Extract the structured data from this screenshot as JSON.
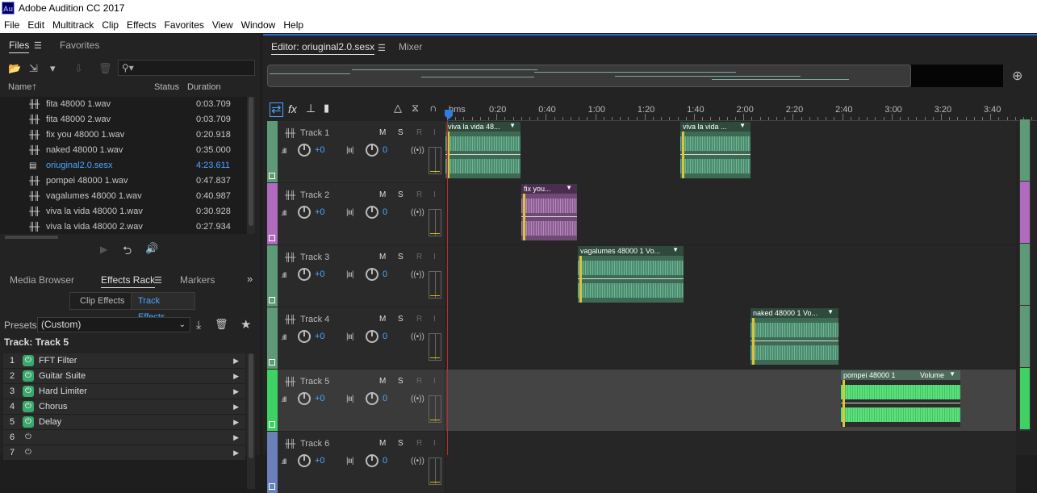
{
  "app": {
    "logo": "Au",
    "title": "Adobe Audition CC 2017"
  },
  "menu": [
    "File",
    "Edit",
    "Multitrack",
    "Clip",
    "Effects",
    "Favorites",
    "View",
    "Window",
    "Help"
  ],
  "files_panel": {
    "tabs": [
      "Files",
      "Favorites"
    ],
    "search_icon": "search-icon",
    "columns": {
      "name": "Name",
      "status": "Status",
      "duration": "Duration"
    },
    "rows": [
      {
        "name": "fita 48000 1.wav",
        "duration": "0:03.709"
      },
      {
        "name": "fita 48000 2.wav",
        "duration": "0:03.709"
      },
      {
        "name": "fix you 48000 1.wav",
        "duration": "0:20.918"
      },
      {
        "name": "naked 48000 1.wav",
        "duration": "0:35.000"
      },
      {
        "name": "oriuginal2.0.sesx",
        "duration": "4:23.611",
        "selected": true
      },
      {
        "name": "pompei 48000 1.wav",
        "duration": "0:47.837"
      },
      {
        "name": "vagalumes 48000 1.wav",
        "duration": "0:40.987"
      },
      {
        "name": "viva la vida 48000 1.wav",
        "duration": "0:30.928"
      },
      {
        "name": "viva la vida 48000 2.wav",
        "duration": "0:27.934"
      }
    ]
  },
  "effects_panel": {
    "tabs": [
      "Media Browser",
      "Effects Rack",
      "Markers"
    ],
    "subtabs": [
      "Clip Effects",
      "Track Effects"
    ],
    "presets_label": "Presets:",
    "presets_value": "(Custom)",
    "track_label": "Track: Track 5",
    "effects": [
      {
        "num": "1",
        "name": "FFT Filter",
        "on": true
      },
      {
        "num": "2",
        "name": "Guitar Suite",
        "on": true
      },
      {
        "num": "3",
        "name": "Hard Limiter",
        "on": true
      },
      {
        "num": "4",
        "name": "Chorus",
        "on": true
      },
      {
        "num": "5",
        "name": "Delay",
        "on": true
      },
      {
        "num": "6",
        "name": "",
        "on": false
      },
      {
        "num": "7",
        "name": "",
        "on": false
      }
    ]
  },
  "editor": {
    "tabs": [
      "Editor: oriuginal2.0.sesx",
      "Mixer"
    ],
    "ruler": [
      "hms",
      "0:20",
      "0:40",
      "1:00",
      "1:20",
      "1:40",
      "2:00",
      "2:20",
      "2:40",
      "3:00",
      "3:20",
      "3:40"
    ],
    "tracks": [
      {
        "name": "Track 1",
        "vol": "+0",
        "pan": "0",
        "color": "#5e9a78"
      },
      {
        "name": "Track 2",
        "vol": "+0",
        "pan": "0",
        "color": "#b06bbf"
      },
      {
        "name": "Track 3",
        "vol": "+0",
        "pan": "0",
        "color": "#5e9a78"
      },
      {
        "name": "Track 4",
        "vol": "+0",
        "pan": "0",
        "color": "#5e9a78"
      },
      {
        "name": "Track 5",
        "vol": "+0",
        "pan": "0",
        "color": "#3fd163"
      },
      {
        "name": "Track 6",
        "vol": "+0",
        "pan": "0",
        "color": "#6b7fb8"
      }
    ],
    "track_buttons": {
      "mute": "M",
      "solo": "S",
      "record": "R",
      "input": "I"
    },
    "clips": [
      {
        "track": 0,
        "title": "viva la vida 48...",
        "style": "green"
      },
      {
        "track": 0,
        "title": "viva la vida ...",
        "style": "green"
      },
      {
        "track": 1,
        "title": "fix you...",
        "style": "purple"
      },
      {
        "track": 2,
        "title": "vagalumes 48000 1 Vo...",
        "style": "green"
      },
      {
        "track": 3,
        "title": "naked 48000 1 Vo...",
        "style": "green"
      },
      {
        "track": 4,
        "title": "pompei 48000 1",
        "extra": "Volume",
        "style": "bright"
      }
    ]
  }
}
